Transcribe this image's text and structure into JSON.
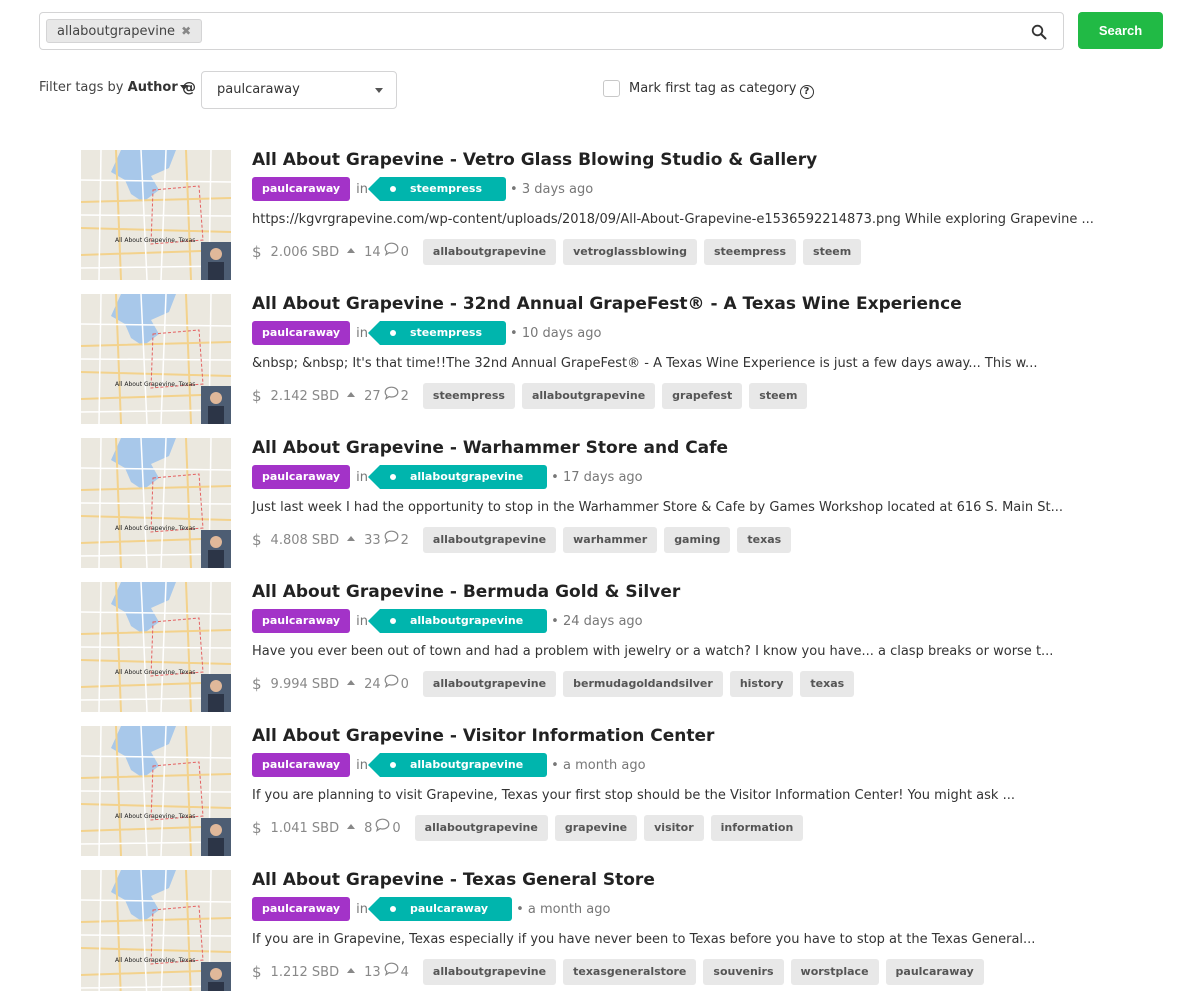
{
  "search": {
    "chip_label": "allaboutgrapevine",
    "chip_remove": "✖",
    "button_label": "Search"
  },
  "filter": {
    "prefix": "Filter tags by ",
    "mode_label": "Author",
    "at_label": "@",
    "selected_author": "paulcaraway",
    "category_label": "Mark first tag as category",
    "help_glyph": "?"
  },
  "thumbnail": {
    "caption": "All About Grapevine, Texas"
  },
  "posts": [
    {
      "title": "All About Grapevine - Vetro Glass Blowing Studio & Gallery",
      "author": "paulcaraway",
      "in_label": "in",
      "category": "steempress",
      "time": "• 3 days ago",
      "snippet": "https://kgvrgrapevine.com/wp-content/uploads/2018/09/All-About-Grapevine-e1536592214873.png While exploring Grapevine ...",
      "payout": "2.006 SBD",
      "votes": "14",
      "comments": "0",
      "tags": [
        "allaboutgrapevine",
        "vetroglassblowing",
        "steempress",
        "steem"
      ]
    },
    {
      "title": "All About Grapevine - 32nd Annual GrapeFest® - A Texas Wine Experience",
      "author": "paulcaraway",
      "in_label": "in",
      "category": "steempress",
      "time": "• 10 days ago",
      "snippet": "&nbsp; &nbsp; It's that time!!The 32nd Annual GrapeFest® - A Texas Wine Experience is just a few days away... This w...",
      "payout": "2.142 SBD",
      "votes": "27",
      "comments": "2",
      "tags": [
        "steempress",
        "allaboutgrapevine",
        "grapefest",
        "steem"
      ]
    },
    {
      "title": "All About Grapevine - Warhammer Store and Cafe",
      "author": "paulcaraway",
      "in_label": "in",
      "category": "allaboutgrapevine",
      "time": "• 17 days ago",
      "snippet": "Just last week I had the opportunity to stop in the Warhammer Store & Cafe by Games Workshop located at 616 S. Main St...",
      "payout": "4.808 SBD",
      "votes": "33",
      "comments": "2",
      "tags": [
        "allaboutgrapevine",
        "warhammer",
        "gaming",
        "texas"
      ]
    },
    {
      "title": "All About Grapevine - Bermuda Gold & Silver",
      "author": "paulcaraway",
      "in_label": "in",
      "category": "allaboutgrapevine",
      "time": "• 24 days ago",
      "snippet": "Have you ever been out of town and had a problem with jewelry or a watch? I know you have... a clasp breaks or worse t...",
      "payout": "9.994 SBD",
      "votes": "24",
      "comments": "0",
      "tags": [
        "allaboutgrapevine",
        "bermudagoldandsilver",
        "history",
        "texas"
      ]
    },
    {
      "title": "All About Grapevine - Visitor Information Center",
      "author": "paulcaraway",
      "in_label": "in",
      "category": "allaboutgrapevine",
      "time": "• a month ago",
      "snippet": "If you are planning to visit Grapevine, Texas your first stop should be the Visitor Information Center! You might ask ...",
      "payout": "1.041 SBD",
      "votes": "8",
      "comments": "0",
      "tags": [
        "allaboutgrapevine",
        "grapevine",
        "visitor",
        "information"
      ]
    },
    {
      "title": "All About Grapevine - Texas General Store",
      "author": "paulcaraway",
      "in_label": "in",
      "category": "paulcaraway",
      "time": "• a month ago",
      "snippet": "If you are in Grapevine, Texas especially if you have never been to Texas before you have to stop at the Texas General...",
      "payout": "1.212 SBD",
      "votes": "13",
      "comments": "4",
      "tags": [
        "allaboutgrapevine",
        "texasgeneralstore",
        "souvenirs",
        "worstplace",
        "paulcaraway"
      ]
    }
  ]
}
